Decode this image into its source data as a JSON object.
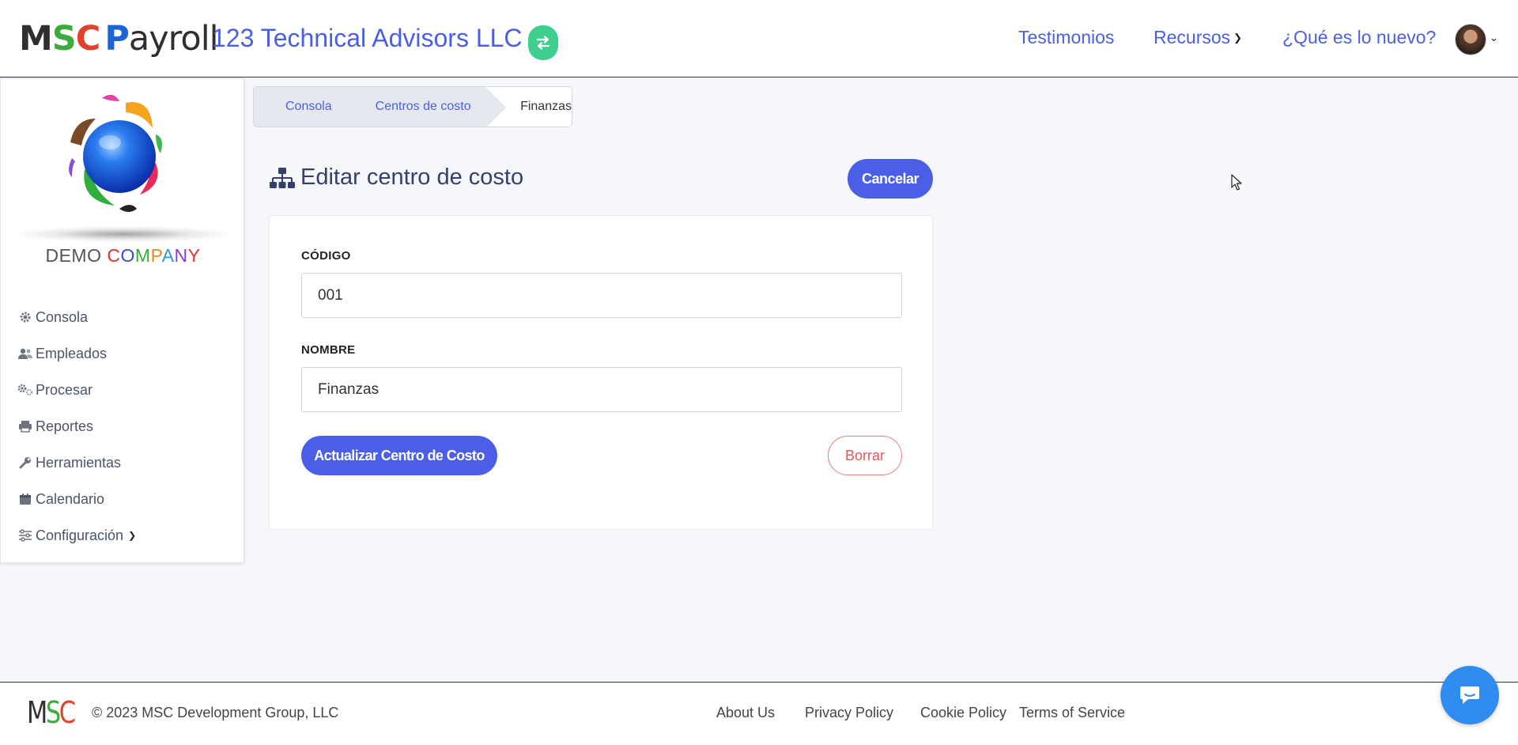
{
  "header": {
    "logo": {
      "m": "M",
      "s": "S",
      "c": "C",
      "p": "P",
      "rest": "ayroll"
    },
    "company_name": "123 Technical Advisors LLC",
    "switch_icon": "switch-arrows-icon",
    "nav": {
      "testimonios": "Testimonios",
      "recursos": "Recursos",
      "nuevo": "¿Qué es lo nuevo?"
    }
  },
  "sidebar": {
    "brand": {
      "demo": "DEMO ",
      "company": [
        "C",
        "O",
        "M",
        "P",
        "A",
        "N",
        "Y"
      ]
    },
    "items": [
      {
        "label": "Consola",
        "icon": "gear-icon"
      },
      {
        "label": "Empleados",
        "icon": "users-icon"
      },
      {
        "label": "Procesar",
        "icon": "cogs-icon"
      },
      {
        "label": "Reportes",
        "icon": "printer-icon"
      },
      {
        "label": "Herramientas",
        "icon": "wrench-icon"
      },
      {
        "label": "Calendario",
        "icon": "calendar-icon"
      },
      {
        "label": "Configuración",
        "icon": "sliders-icon"
      }
    ]
  },
  "breadcrumb": {
    "items": [
      "Consola",
      "Centros de costo",
      "Finanzas"
    ]
  },
  "main": {
    "title": "Editar centro de costo",
    "cancel_label": "Cancelar",
    "form": {
      "codigo_label": "CÓDIGO",
      "codigo_value": "001",
      "nombre_label": "NOMBRE",
      "nombre_value": "Finanzas",
      "update_label": "Actualizar Centro de Costo",
      "delete_label": "Borrar"
    }
  },
  "footer": {
    "logo": {
      "m": "M",
      "s": "S",
      "c": "C"
    },
    "copyright": "© 2023 MSC Development Group, LLC",
    "links": [
      "About Us",
      "Privacy Policy",
      "Cookie Policy",
      "Terms of Service"
    ]
  },
  "colors": {
    "primary": "#4b5fe6",
    "success": "#3ecf8e",
    "danger": "#e15757",
    "chat": "#2f8cf0"
  }
}
